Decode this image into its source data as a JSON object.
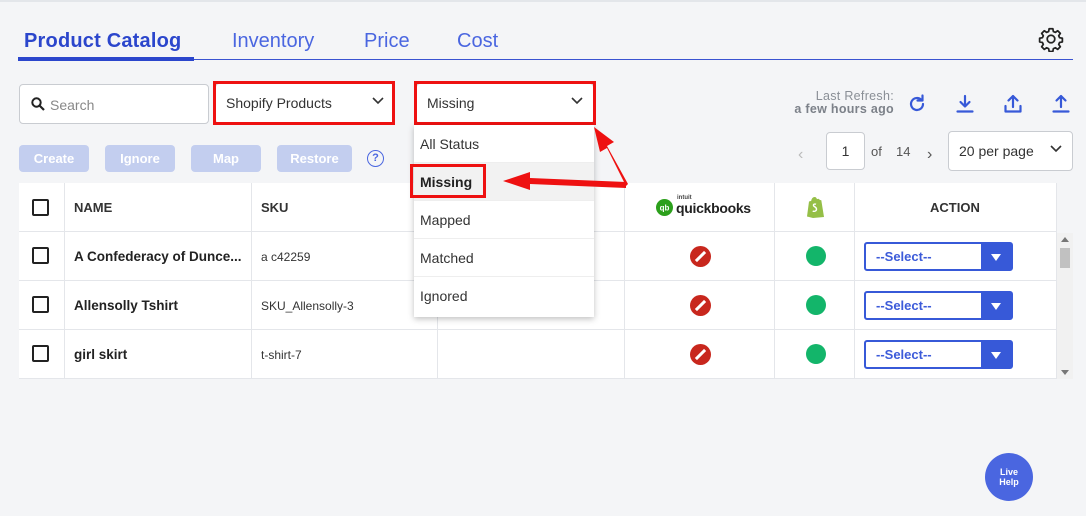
{
  "tabs": [
    {
      "label": "Product Catalog"
    },
    {
      "label": "Inventory"
    },
    {
      "label": "Price"
    },
    {
      "label": "Cost"
    }
  ],
  "search": {
    "placeholder": "Search"
  },
  "filters": {
    "product_source": "Shopify Products",
    "status": "Missing"
  },
  "refresh": {
    "label": "Last Refresh:",
    "time": "a few hours ago"
  },
  "actions": {
    "create": "Create",
    "ignore": "Ignore",
    "map": "Map",
    "restore": "Restore",
    "help": "?"
  },
  "pagination": {
    "current_page": "1",
    "of_label": "of",
    "total_pages": "14",
    "per_page": "20 per page"
  },
  "table": {
    "headers": {
      "name": "NAME",
      "sku": "SKU",
      "quickbooks_prefix": "intuit",
      "quickbooks": "quickbooks",
      "action": "ACTION"
    },
    "rows": [
      {
        "name": "A Confederacy of Dunce...",
        "sku": "a c42259",
        "qb_status": "not-synced",
        "shopify_status": "active",
        "action": "--Select--"
      },
      {
        "name": "Allensolly Tshirt",
        "sku": "SKU_Allensolly-3",
        "qb_status": "not-synced",
        "shopify_status": "active",
        "action": "--Select--"
      },
      {
        "name": "girl skirt",
        "sku": "t-shirt-7",
        "qb_status": "not-synced",
        "shopify_status": "active",
        "action": "--Select--"
      }
    ]
  },
  "status_dropdown": {
    "options": [
      {
        "label": "All Status"
      },
      {
        "label": "Missing"
      },
      {
        "label": "Mapped"
      },
      {
        "label": "Matched"
      },
      {
        "label": "Ignored"
      }
    ],
    "selected": "Missing"
  },
  "live_help": {
    "line1": "Live",
    "line2": "Help"
  },
  "colors": {
    "accent": "#2b46cc",
    "highlight": "#ee1111",
    "ok": "#13b56a",
    "error": "#c8271d",
    "quickbooks": "#2ca01c",
    "shopify": "#95bf47"
  },
  "icons": [
    "search-icon",
    "gear-icon",
    "chevron-down-icon",
    "refresh-icon",
    "download-icon",
    "upload-icon",
    "export-icon",
    "help-icon",
    "quickbooks-logo-icon",
    "shopify-logo-icon"
  ]
}
